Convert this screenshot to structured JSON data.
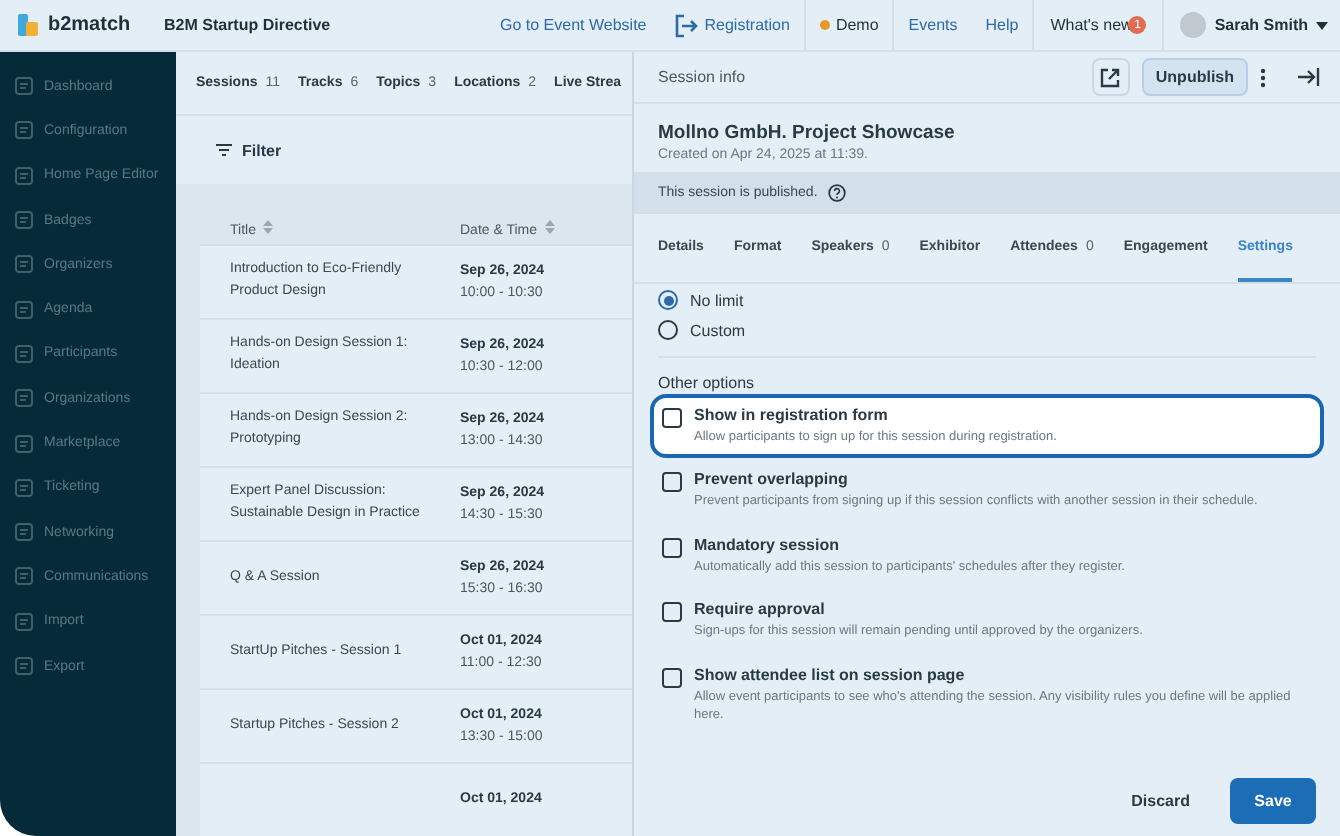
{
  "topbar": {
    "logo": "b2match",
    "event": "B2M Startup Directive",
    "links": [
      {
        "label": "Go to Event Website",
        "kind": "link"
      },
      {
        "label": "Registration",
        "kind": "icon-link"
      },
      {
        "label": "Demo",
        "kind": "status"
      },
      {
        "label": "Events",
        "kind": "link"
      },
      {
        "label": "Help",
        "kind": "link"
      }
    ],
    "whats_new": {
      "label": "What's new",
      "badge": "1"
    },
    "user": "Sarah Smith"
  },
  "sidebar": {
    "items": [
      {
        "label": "Dashboard"
      },
      {
        "label": "Configuration"
      },
      {
        "label": "Home Page Editor"
      },
      {
        "label": "Badges"
      },
      {
        "label": "Organizers"
      },
      {
        "label": "Agenda"
      },
      {
        "label": "Participants"
      },
      {
        "label": "Organizations"
      },
      {
        "label": "Marketplace"
      },
      {
        "label": "Ticketing"
      },
      {
        "label": "Networking"
      },
      {
        "label": "Communications"
      },
      {
        "label": "Import"
      },
      {
        "label": "Export"
      }
    ]
  },
  "agenda": {
    "tabs": [
      {
        "label": "Sessions",
        "count": "11"
      },
      {
        "label": "Tracks",
        "count": "6"
      },
      {
        "label": "Topics",
        "count": "3"
      },
      {
        "label": "Locations",
        "count": "2"
      },
      {
        "label": "Live Strea"
      }
    ],
    "filter": "Filter",
    "table": {
      "columns": [
        "Title",
        "Date & Time"
      ],
      "rows": [
        {
          "title": "Introduction to Eco-Friendly Product Design",
          "date": "Sep 26, 2024",
          "time": "10:00 - 10:30"
        },
        {
          "title": "Hands-on Design Session 1: Ideation",
          "date": "Sep 26, 2024",
          "time": "10:30 - 12:00"
        },
        {
          "title": "Hands-on Design Session 2: Prototyping",
          "date": "Sep 26, 2024",
          "time": "13:00 - 14:30"
        },
        {
          "title": "Expert Panel Discussion: Sustainable Design in Practice",
          "date": "Sep 26, 2024",
          "time": "14:30 - 15:30"
        },
        {
          "title": "Q & A Session",
          "date": "Sep 26, 2024",
          "time": "15:30 - 16:30"
        },
        {
          "title": "StartUp Pitches - Session 1",
          "date": "Oct 01, 2024",
          "time": "11:00 - 12:30"
        },
        {
          "title": "Startup Pitches - Session 2",
          "date": "Oct 01, 2024",
          "time": "13:30 - 15:00"
        },
        {
          "date": "Oct 01, 2024"
        }
      ]
    }
  },
  "panel": {
    "title": "Session info",
    "unpublish": "Unpublish",
    "session_name": "Mollno GmbH. Project Showcase",
    "created": "Created on Apr 24, 2025 at 11:39.",
    "published_note": "This session is published.",
    "tabs": [
      {
        "label": "Details",
        "selected": false
      },
      {
        "label": "Format",
        "selected": false
      },
      {
        "label": "Speakers",
        "count": "0",
        "selected": false
      },
      {
        "label": "Exhibitor",
        "selected": false
      },
      {
        "label": "Attendees",
        "count": "0",
        "selected": false
      },
      {
        "label": "Engagement",
        "selected": false
      },
      {
        "label": "Settings",
        "selected": true
      }
    ],
    "radios": [
      {
        "label": "No limit",
        "selected": true
      },
      {
        "label": "Custom",
        "selected": false
      }
    ],
    "other_options_heading": "Other options",
    "options": [
      {
        "label": "Show in registration form",
        "description": "Allow participants to sign up for this session during registration.",
        "checked": false,
        "highlighted": true
      },
      {
        "label": "Prevent overlapping",
        "description": "Prevent participants from signing up if this session conflicts with another session in their schedule.",
        "checked": false,
        "highlighted": false
      },
      {
        "label": "Mandatory session",
        "description": "Automatically add this session to participants' schedules after they register.",
        "checked": false,
        "highlighted": false
      },
      {
        "label": "Require approval",
        "description": "Sign-ups for this session will remain pending until approved by the organizers.",
        "checked": false,
        "highlighted": false
      },
      {
        "label": "Show attendee list on session page",
        "description": "Allow event participants to see who's attending the session. Any visibility rules you define will be applied here.",
        "checked": false,
        "highlighted": false
      }
    ],
    "discard": "Discard",
    "save": "Save"
  }
}
